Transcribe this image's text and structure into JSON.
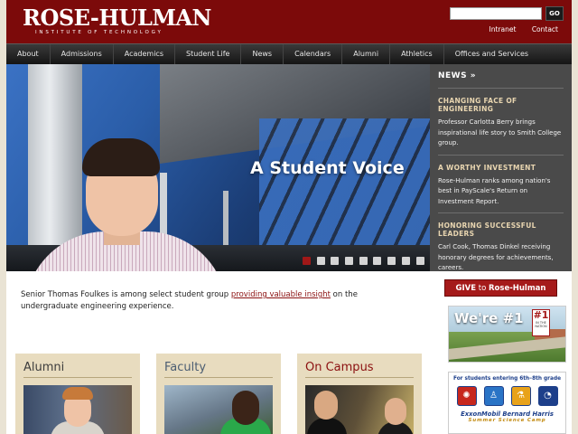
{
  "header": {
    "logo_main": "ROSE-HULMAN",
    "logo_sub": "INSTITUTE OF TECHNOLOGY",
    "search_placeholder": "",
    "search_button": "GO",
    "util_links": [
      "Intranet",
      "Contact"
    ]
  },
  "nav": {
    "items": [
      "About",
      "Admissions",
      "Academics",
      "Student Life",
      "News",
      "Calendars",
      "Alumni",
      "Athletics",
      "Offices and Services"
    ]
  },
  "hero": {
    "headline": "A Student Voice",
    "slide_count": 9,
    "active_slide": 1
  },
  "news": {
    "header": "NEWS »",
    "items": [
      {
        "title": "CHANGING FACE OF ENGINEERING",
        "text": "Professor Carlotta Berry brings inspirational life story to Smith College group."
      },
      {
        "title": "A WORTHY INVESTMENT",
        "text": "Rose-Hulman ranks among nation's best in PayScale's Return on Investment Report."
      },
      {
        "title": "HONORING SUCCESSFUL LEADERS",
        "text": "Carl Cook, Thomas Dinkel receiving honorary degrees for achievements, careers."
      }
    ]
  },
  "caption": {
    "before": "Senior Thomas Foulkes is among select student group ",
    "link": "providing valuable insight",
    "after": " on the undergraduate engineering experience."
  },
  "promos": {
    "give_pre": "GIVE",
    "give_mid": " to ",
    "give_post": "Rose-Hulman",
    "rank_headline": "We're #1",
    "rank_sign_num": "#1",
    "rank_sign_text": "IN THE NATION",
    "camp_top": "For students entering 6th–8th grade",
    "camp_name": "ExxonMobil Bernard Harris",
    "camp_sub": "Summer Science Camp"
  },
  "cards": [
    {
      "title": "Alumni",
      "color": "#3d3d3d"
    },
    {
      "title": "Faculty",
      "color": "#4b5d72"
    },
    {
      "title": "On Campus",
      "color": "#8b1010"
    }
  ],
  "colors": {
    "brand": "#7c0a0a",
    "accent_link": "#8b1010",
    "news_title": "#e8d5b0",
    "card_bg": "#e8dcbf"
  }
}
